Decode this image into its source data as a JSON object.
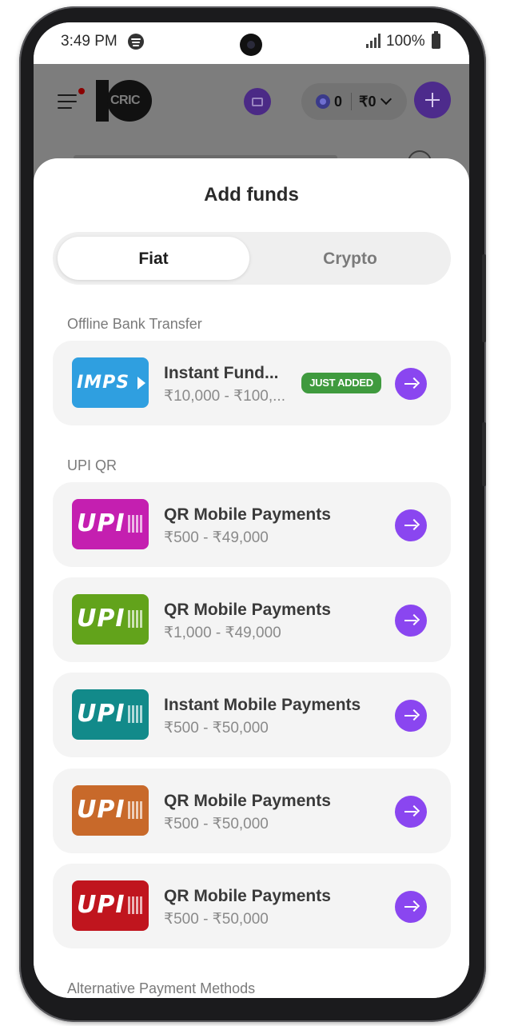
{
  "status_bar": {
    "time": "3:49 PM",
    "battery": "100%"
  },
  "header": {
    "logo_text": "CRIC",
    "coins": "0",
    "balance": "₹0"
  },
  "sheet": {
    "title": "Add funds",
    "tabs": [
      {
        "label": "Fiat",
        "active": true
      },
      {
        "label": "Crypto",
        "active": false
      }
    ],
    "sections": [
      {
        "label": "Offline Bank Transfer",
        "methods": [
          {
            "logo": "IMPS",
            "logo_color": "#2f9fe0",
            "title": "Instant Fund...",
            "range": "₹10,000 - ₹100,...",
            "badge": "JUST ADDED"
          }
        ]
      },
      {
        "label": "UPI QR",
        "methods": [
          {
            "logo": "UPI",
            "logo_color": "#c41fb0",
            "title": "QR Mobile Payments",
            "range": "₹500 - ₹49,000"
          },
          {
            "logo": "UPI",
            "logo_color": "#62a31b",
            "title": "QR Mobile Payments",
            "range": "₹1,000 - ₹49,000"
          },
          {
            "logo": "UPI",
            "logo_color": "#128a8a",
            "title": "Instant Mobile Payments",
            "range": "₹500 - ₹50,000"
          },
          {
            "logo": "UPI",
            "logo_color": "#c8692a",
            "title": "QR Mobile Payments",
            "range": "₹500 - ₹50,000"
          },
          {
            "logo": "UPI",
            "logo_color": "#c0151e",
            "title": "QR Mobile Payments",
            "range": "₹500 - ₹50,000"
          }
        ]
      },
      {
        "label": "Alternative Payment Methods",
        "methods": []
      }
    ]
  },
  "colors": {
    "accent": "#8a46f0",
    "badge": "#3f9a3e",
    "imps": "#2f9fe0"
  },
  "icons": [
    "menu-icon",
    "gift-icon",
    "coin-icon",
    "chevron-down-icon",
    "plus-icon",
    "search-icon",
    "arrow-right-icon",
    "qr-code-icon"
  ]
}
